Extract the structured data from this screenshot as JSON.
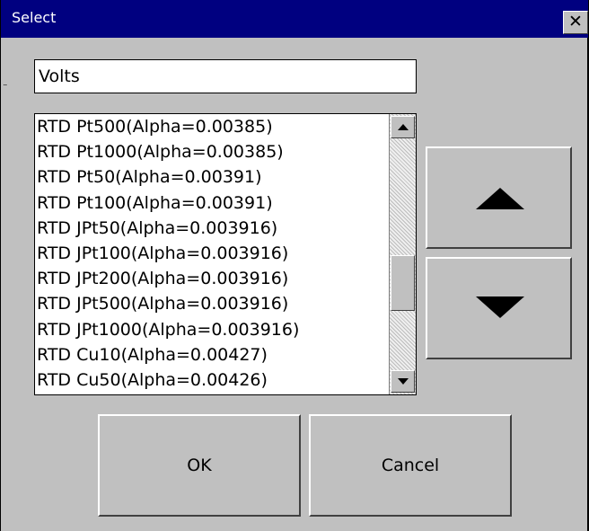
{
  "window": {
    "title": "Select",
    "close_glyph": "✕",
    "edge_fragment": "¨"
  },
  "selected_text": "Volts",
  "list": {
    "items": [
      "RTD Pt500(Alpha=0.00385)",
      "RTD Pt1000(Alpha=0.00385)",
      "RTD Pt50(Alpha=0.00391)",
      "RTD Pt100(Alpha=0.00391)",
      "RTD JPt50(Alpha=0.003916)",
      "RTD JPt100(Alpha=0.003916)",
      "RTD JPt200(Alpha=0.003916)",
      "RTD JPt500(Alpha=0.003916)",
      "RTD JPt1000(Alpha=0.003916)",
      "RTD Cu10(Alpha=0.00427)",
      "RTD Cu50(Alpha=0.00426)"
    ],
    "scroll_position_fraction": 0.62
  },
  "buttons": {
    "move_up_icon": "arrow-up-icon",
    "move_down_icon": "arrow-down-icon",
    "ok_label": "OK",
    "cancel_label": "Cancel"
  },
  "colors": {
    "titlebar": "#000080",
    "face": "#c0c0c0"
  }
}
